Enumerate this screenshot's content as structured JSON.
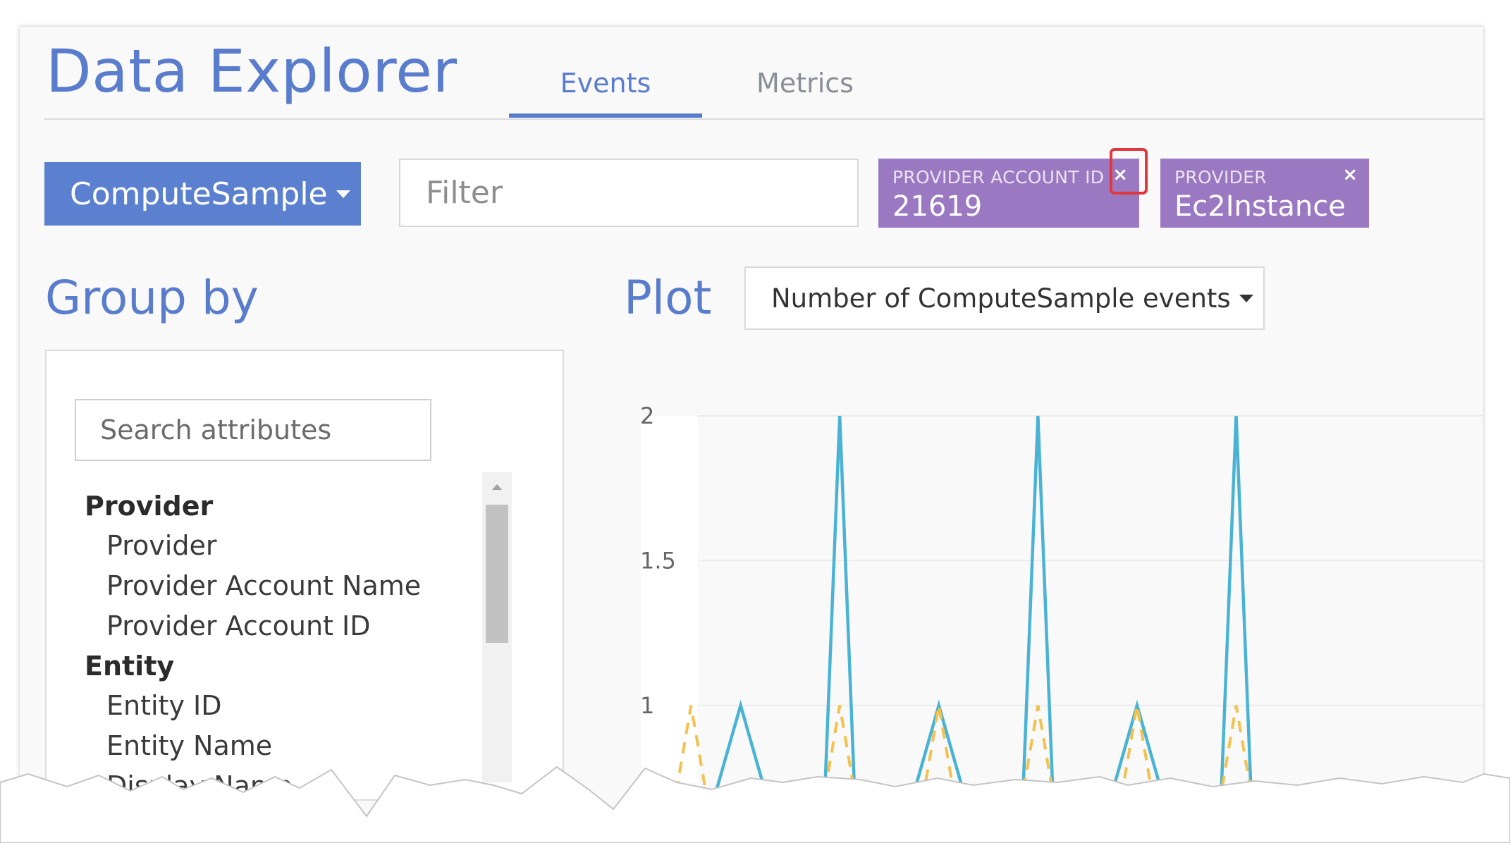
{
  "header": {
    "title": "Data Explorer",
    "tabs": [
      {
        "label": "Events",
        "active": true
      },
      {
        "label": "Metrics",
        "active": false
      }
    ]
  },
  "toolbar": {
    "event_type_label": "ComputeSample",
    "event_type_icon": "caret-down-icon",
    "filter_placeholder": "Filter",
    "filter_value": "",
    "chips": [
      {
        "label": "PROVIDER ACCOUNT ID",
        "value": "21619",
        "close": "×"
      },
      {
        "label": "PROVIDER",
        "value": "Ec2Instance",
        "close": "×"
      }
    ]
  },
  "group_by": {
    "title": "Group by",
    "search_placeholder": "Search attributes",
    "groups": [
      {
        "heading": "Provider",
        "items": [
          "Provider",
          "Provider Account Name",
          "Provider Account ID"
        ]
      },
      {
        "heading": "Entity",
        "items": [
          "Entity ID",
          "Entity Name",
          "Display Name"
        ]
      }
    ]
  },
  "plot": {
    "title": "Plot",
    "metric_label": "Number of ComputeSample events"
  },
  "colors": {
    "accent": "#5a7ccc",
    "chip": "#9a78c2",
    "highlight": "#e0383b",
    "series_solid": "#4ab3d4",
    "series_dashed": "#f2c14e"
  },
  "chart_data": {
    "type": "line",
    "yticks": [
      "2",
      "1.5",
      "1"
    ],
    "ylim": [
      0.7,
      2
    ],
    "xlim": [
      0,
      17
    ],
    "grid": true,
    "series": [
      {
        "style": "solid",
        "color": "#4ab3d4",
        "points": [
          [
            1.5,
            0.7
          ],
          [
            2,
            1
          ],
          [
            2.5,
            0.7
          ],
          [
            3.7,
            0.7
          ],
          [
            4,
            2
          ],
          [
            4.3,
            0.7
          ],
          [
            5.5,
            0.7
          ],
          [
            6,
            1
          ],
          [
            6.5,
            0.7
          ],
          [
            7.7,
            0.7
          ],
          [
            8,
            2
          ],
          [
            8.3,
            0.7
          ],
          [
            9.5,
            0.7
          ],
          [
            10,
            1
          ],
          [
            10.5,
            0.7
          ],
          [
            11.7,
            0.7
          ],
          [
            12,
            2
          ],
          [
            12.3,
            0.7
          ]
        ]
      },
      {
        "style": "dashed",
        "color": "#f2c14e",
        "points": [
          [
            0.7,
            0.7
          ],
          [
            1,
            1
          ],
          [
            1.3,
            0.7
          ],
          [
            3.7,
            0.7
          ],
          [
            4,
            1
          ],
          [
            4.3,
            0.7
          ],
          [
            5.7,
            0.7
          ],
          [
            6,
            1
          ],
          [
            6.3,
            0.7
          ],
          [
            7.7,
            0.7
          ],
          [
            8,
            1
          ],
          [
            8.3,
            0.7
          ],
          [
            9.7,
            0.7
          ],
          [
            10,
            1
          ],
          [
            10.3,
            0.7
          ],
          [
            11.7,
            0.7
          ],
          [
            12,
            1
          ],
          [
            12.3,
            0.7
          ]
        ]
      }
    ]
  }
}
